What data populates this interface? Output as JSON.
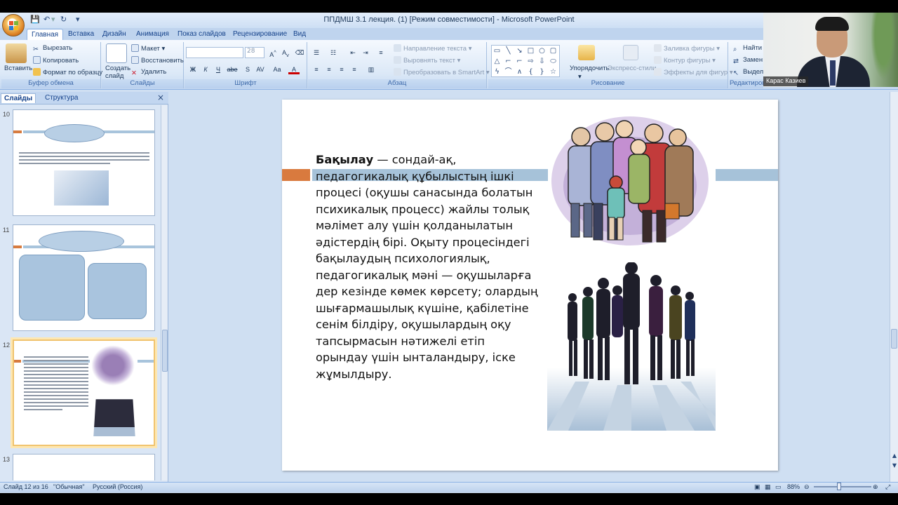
{
  "window": {
    "title": "ППДМШ  3.1 лекция. (1) [Режим совместимости] - Microsoft PowerPoint"
  },
  "ribbon_tabs": [
    "Главная",
    "Вставка",
    "Дизайн",
    "Анимация",
    "Показ слайдов",
    "Рецензирование",
    "Вид"
  ],
  "clipboard": {
    "paste": "Вставить",
    "cut": "Вырезать",
    "copy": "Копировать",
    "format_painter": "Формат по образцу",
    "label": "Буфер обмена"
  },
  "slides_group": {
    "new_slide_1": "Создать",
    "new_slide_2": "слайд",
    "layout": "Макет",
    "reset": "Восстановить",
    "delete": "Удалить",
    "label": "Слайды"
  },
  "font_group": {
    "size": "28",
    "label": "Шрифт",
    "bold": "Ж",
    "italic": "К",
    "underline": "Ч",
    "strike": "abe",
    "shadow": "S",
    "spacing": "AV",
    "case": "Aa",
    "color": "A"
  },
  "paragraph_group": {
    "text_direction": "Направление текста",
    "align_text": "Выровнять текст",
    "smartart": "Преобразовать в SmartArt",
    "label": "Абзац"
  },
  "drawing_group": {
    "arrange": "Упорядочить",
    "quick_styles": "Экспресс-стили",
    "shape_fill": "Заливка фигуры",
    "shape_outline": "Контур фигуры",
    "shape_effects": "Эффекты для фигур",
    "label": "Рисование"
  },
  "editing_group": {
    "find": "Найти",
    "replace": "Замен",
    "select": "Выдел",
    "label": "Редактирова"
  },
  "video": {
    "name": "Карас Казиев"
  },
  "panel": {
    "tab_slides": "Слайды",
    "tab_outline": "Структура",
    "close": "×",
    "thumbnails": [
      {
        "number": "10"
      },
      {
        "number": "11"
      },
      {
        "number": "12"
      },
      {
        "number": "13"
      }
    ]
  },
  "slide": {
    "text_bold": "Бақылау",
    "text_rest": " — сондай-ақ, педагогикалық құбылыстың ішкі процесі (оқушы санасында болатын психикалық процесс) жайлы толық мәлімет алу үшін қолданылатын әдістердің бірі. Оқыту процесіндегі бақылаудың психологиялық, педагогикалық мәні — оқушыларға дер кезінде көмек көрсету; олардың шығармашылық күшіне, қабілетіне сенім білдіру, оқушылардың оқу тапсырмасын нәтижелі етіп орындау үшін ынталандыру, іске жұмылдыру."
  },
  "status": {
    "slide_info": "Слайд 12 из 16",
    "theme": "\"Обычная\"",
    "language": "Русский (Россия)",
    "zoom": "88%"
  }
}
